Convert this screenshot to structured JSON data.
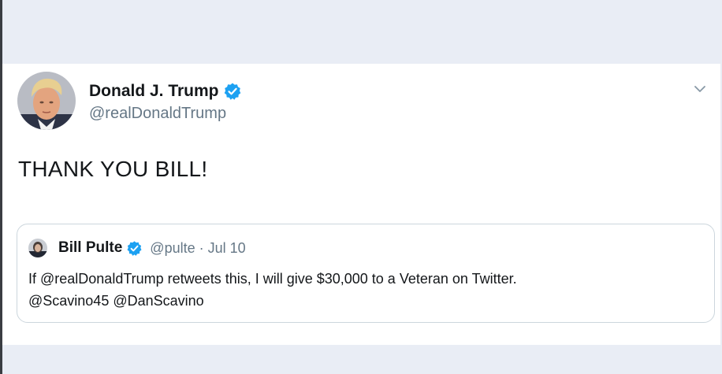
{
  "tweet": {
    "author": {
      "name": "Donald J. Trump",
      "handle": "@realDonaldTrump",
      "verified": true
    },
    "text": "THANK YOU BILL!",
    "menu_icon": "chevron-down-icon",
    "quoted_tweet": {
      "author_name": "Bill Pulte",
      "handle": "@pulte",
      "separator": "·",
      "date": "Jul 10",
      "verified": true,
      "text_line_1": "If @realDonaldTrump retweets this, I will give $30,000 to a Veteran on Twitter.",
      "text_line_2": "@Scavino45 @DanScavino"
    }
  },
  "colors": {
    "background": "#e9edf5",
    "card": "#ffffff",
    "verified_blue": "#1da1f2",
    "secondary_text": "#657786",
    "border": "#ccd6dd"
  }
}
